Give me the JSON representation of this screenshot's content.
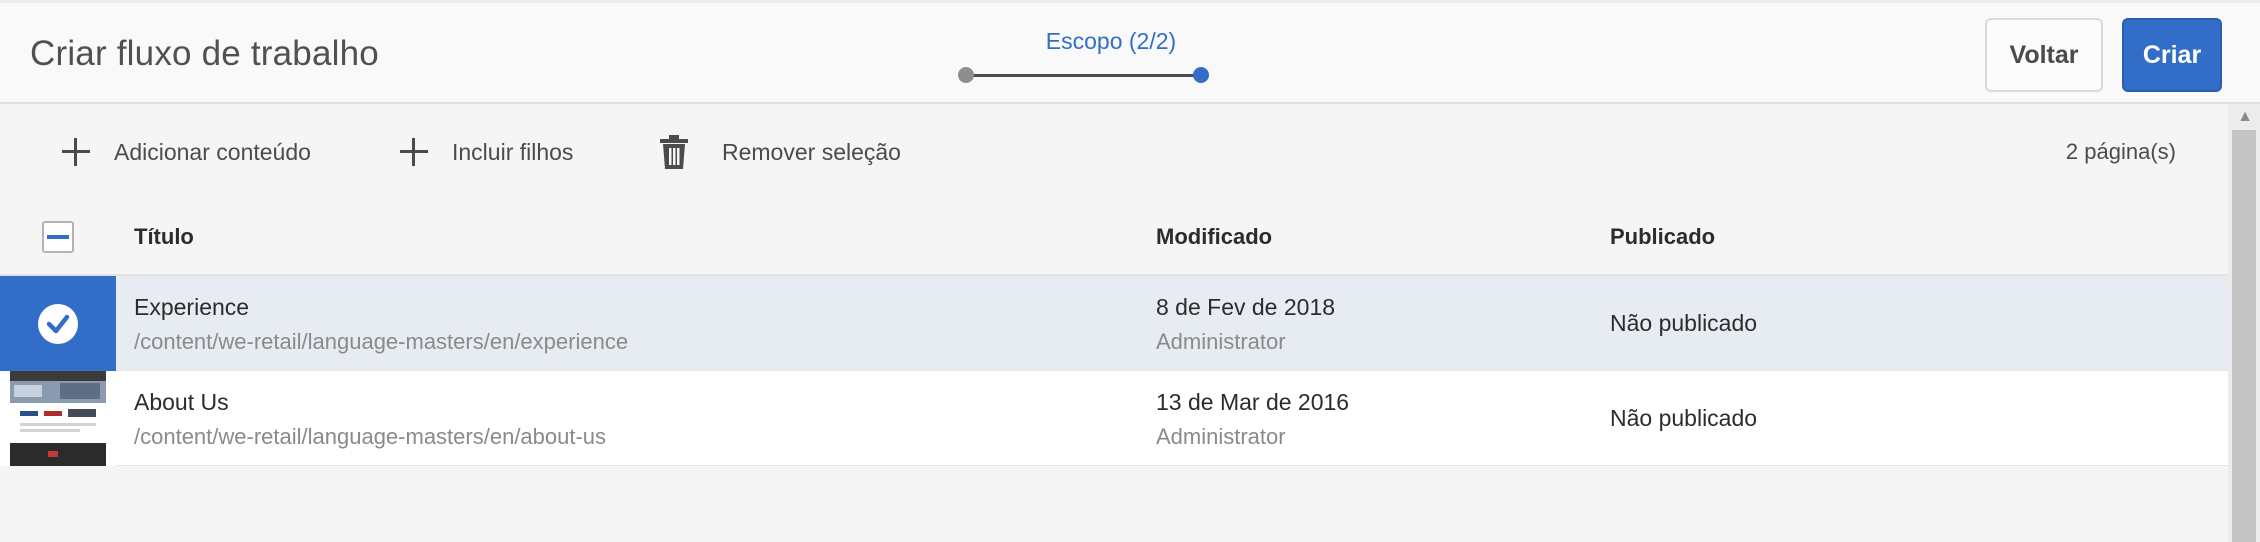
{
  "header": {
    "title": "Criar fluxo de trabalho",
    "wizard_step": "Escopo (2/2)",
    "back_label": "Voltar",
    "create_label": "Criar"
  },
  "actions": {
    "add_content": "Adicionar conteúdo",
    "include_children": "Incluir filhos",
    "remove_selection": "Remover seleção",
    "page_count": "2 página(s)"
  },
  "table": {
    "columns": [
      "Título",
      "Modificado",
      "Publicado"
    ],
    "rows": [
      {
        "title": "Experience",
        "path": "/content/we-retail/language-masters/en/experience",
        "modified_date": "8 de Fev de 2018",
        "modified_by": "Administrator",
        "published": "Não publicado",
        "selected": true
      },
      {
        "title": "About Us",
        "path": "/content/we-retail/language-masters/en/about-us",
        "modified_date": "13 de Mar de 2016",
        "modified_by": "Administrator",
        "published": "Não publicado",
        "selected": false
      }
    ]
  },
  "colors": {
    "accent": "#326ec8",
    "selected_row": "#e7ebf2"
  },
  "icons": [
    "plus-icon",
    "trash-icon",
    "check-icon",
    "chevron-up-icon"
  ]
}
